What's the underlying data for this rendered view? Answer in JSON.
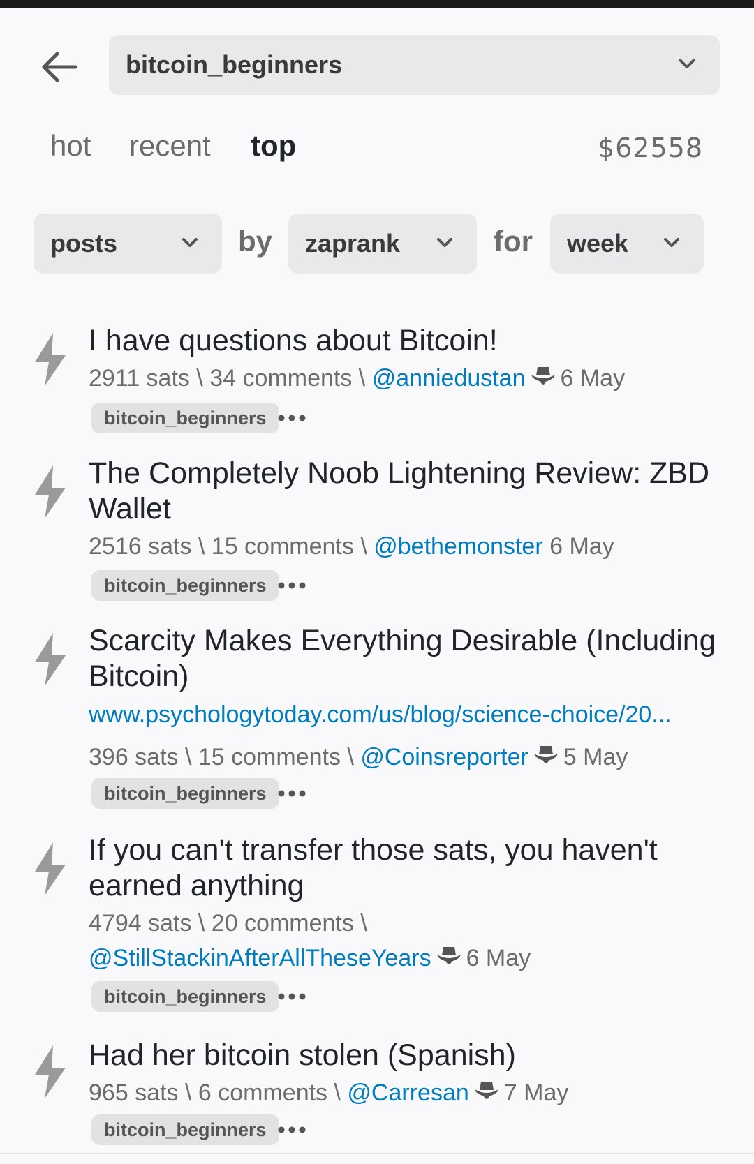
{
  "header": {
    "sub_name": "bitcoin_beginners"
  },
  "tabs": [
    {
      "label": "hot",
      "active": false
    },
    {
      "label": "recent",
      "active": false
    },
    {
      "label": "top",
      "active": true
    }
  ],
  "price": "$62558",
  "filters": {
    "type_value": "posts",
    "by_word": "by",
    "sort_value": "zaprank",
    "for_word": "for",
    "period_value": "week"
  },
  "posts": [
    {
      "title": "I have questions about Bitcoin!",
      "sats": "2911 sats",
      "sep1": " \\ ",
      "comments": "34 comments",
      "sep2": " \\ ",
      "user": "@anniedustan",
      "date": "6 May",
      "sub": "bitcoin_beginners"
    },
    {
      "title": "The Completely Noob Lightening Review: ZBD Wallet",
      "sats": "2516 sats",
      "sep1": " \\ ",
      "comments": "15 comments",
      "sep2": " \\ ",
      "user": "@bethemonster",
      "date": "6 May",
      "sub": "bitcoin_beginners"
    },
    {
      "title": "Scarcity Makes Everything Desirable (Including Bitcoin)",
      "link": "www.psychologytoday.com/us/blog/science-choice/20...",
      "sats": "396 sats",
      "sep1": " \\ ",
      "comments": "15 comments",
      "sep2": " \\ ",
      "user": "@Coinsreporter",
      "date": "5 May",
      "sub": "bitcoin_beginners"
    },
    {
      "title": "If you can't transfer those sats, you haven't earned anything",
      "sats": "4794 sats",
      "sep1": " \\ ",
      "comments": "20 comments",
      "sep2": " \\ ",
      "user": "@StillStackinAfterAllTheseYears",
      "date": "6 May",
      "sub": "bitcoin_beginners"
    },
    {
      "title": "Had her bitcoin stolen (Spanish)",
      "sats": "965 sats",
      "sep1": " \\ ",
      "comments": "6 comments",
      "sep2": " \\ ",
      "user": "@Carresan",
      "date": "7 May",
      "sub": "bitcoin_beginners"
    }
  ],
  "colors": {
    "link": "#007cbe",
    "muted": "#6c6c6c",
    "chip_bg": "#e9e9eb",
    "bolt": "#9a9a9a"
  }
}
